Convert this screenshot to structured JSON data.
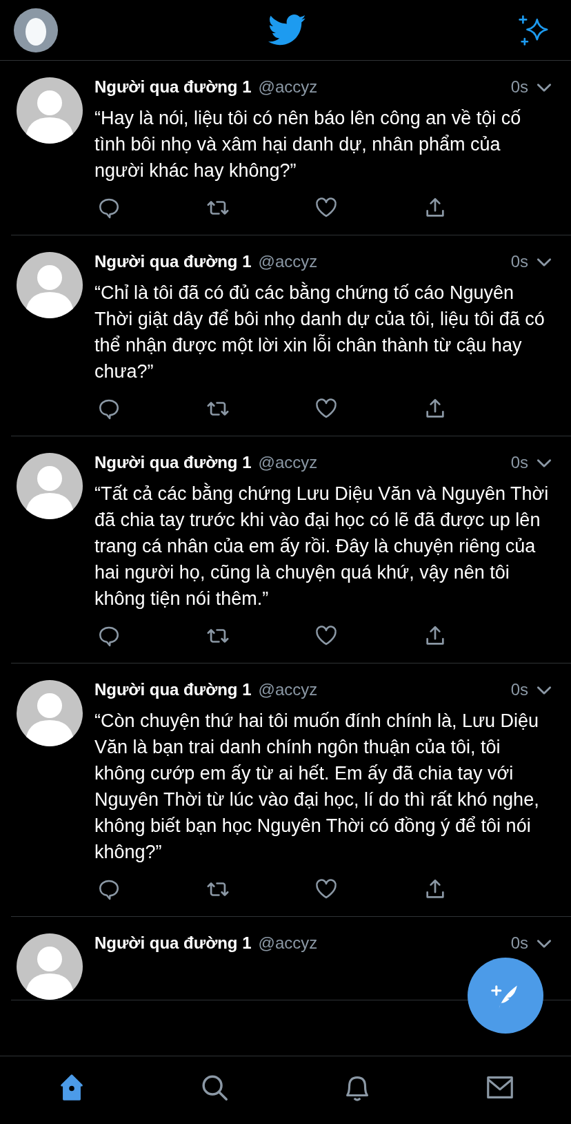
{
  "tweets": [
    {
      "name": "Người qua đường 1",
      "handle": "@accyz",
      "time": "0s",
      "text": "“Hay là nói, liệu tôi có nên báo lên công an về tội cố tình bôi nhọ và xâm hại danh dự, nhân phẩm của người khác hay không?”"
    },
    {
      "name": "Người qua đường 1",
      "handle": "@accyz",
      "time": "0s",
      "text": "“Chỉ là tôi đã có đủ các bằng chứng tố cáo Nguyên Thời giật dây để bôi nhọ danh dự của tôi, liệu tôi đã có thể nhận được một lời xin lỗi chân thành từ cậu hay chưa?”"
    },
    {
      "name": "Người qua đường 1",
      "handle": "@accyz",
      "time": "0s",
      "text": "“Tất cả các bằng chứng Lưu Diệu Văn và Nguyên Thời đã chia tay trước khi vào đại học có lẽ đã được up lên trang cá nhân của em ấy rồi. Đây là chuyện riêng của hai người họ, cũng là chuyện quá khứ, vậy nên tôi không tiện nói thêm.”"
    },
    {
      "name": "Người qua đường 1",
      "handle": "@accyz",
      "time": "0s",
      "text": "“Còn chuyện thứ hai tôi muốn đính chính là, Lưu Diệu Văn là bạn trai danh chính ngôn thuận của tôi, tôi không cướp em ấy từ ai hết. Em ấy đã chia tay với Nguyên Thời từ lúc vào đại học, lí do thì rất khó nghe, không biết bạn học Nguyên Thời có đồng ý để tôi nói không?”"
    },
    {
      "name": "Người qua đường 1",
      "handle": "@accyz",
      "time": "0s"
    }
  ],
  "tab_bar": [
    {
      "kind": "home",
      "selected": true
    },
    {
      "kind": "search",
      "selected": false
    },
    {
      "kind": "bell",
      "selected": false
    },
    {
      "kind": "mail",
      "selected": false
    }
  ]
}
